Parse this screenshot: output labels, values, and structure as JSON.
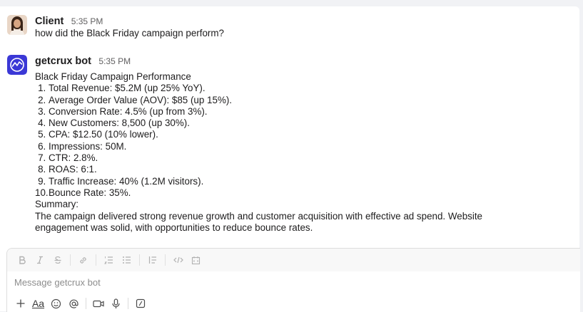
{
  "messages": [
    {
      "sender": "Client",
      "time": "5:35 PM",
      "avatar": "client-avatar",
      "text": "how did the Black Friday campaign perform?"
    },
    {
      "sender": "getcrux bot",
      "time": "5:35 PM",
      "avatar": "getcrux-logo",
      "heading": "Black Friday Campaign Performance",
      "items": [
        {
          "num": "1.",
          "text": "Total Revenue: $5.2M (up 25% YoY)."
        },
        {
          "num": "2.",
          "text": "Average Order Value (AOV): $85 (up 15%)."
        },
        {
          "num": "3.",
          "text": "Conversion Rate: 4.5% (up from 3%)."
        },
        {
          "num": "4.",
          "text": "New Customers: 8,500 (up 30%)."
        },
        {
          "num": "5.",
          "text": "CPA: $12.50 (10% lower)."
        },
        {
          "num": "6.",
          "text": "Impressions: 50M."
        },
        {
          "num": "7.",
          "text": "CTR: 2.8%."
        },
        {
          "num": "8.",
          "text": "ROAS: 6:1."
        },
        {
          "num": "9.",
          "text": "Traffic Increase: 40% (1.2M visitors)."
        },
        {
          "num": "10.",
          "text": "Bounce Rate: 35%."
        }
      ],
      "summary_label": "Summary:",
      "summary_text": "The campaign delivered strong revenue growth and customer acquisition with effective ad spend. Website engagement was solid, with opportunities to reduce bounce rates."
    }
  ],
  "composer": {
    "placeholder": "Message getcrux bot",
    "format_tools": [
      "bold-icon",
      "italic-icon",
      "strikethrough-icon",
      "link-icon",
      "ordered-list-icon",
      "bulleted-list-icon",
      "blockquote-icon",
      "code-icon",
      "code-block-icon"
    ],
    "actions": [
      "plus-icon",
      "text-format-icon",
      "emoji-icon",
      "mention-icon",
      "video-icon",
      "microphone-icon",
      "slash-command-icon"
    ],
    "text_format_label": "Aa"
  },
  "colors": {
    "bot_logo_bg": "#3b38d6",
    "background": "#f1f2f5",
    "panel": "#ffffff"
  }
}
